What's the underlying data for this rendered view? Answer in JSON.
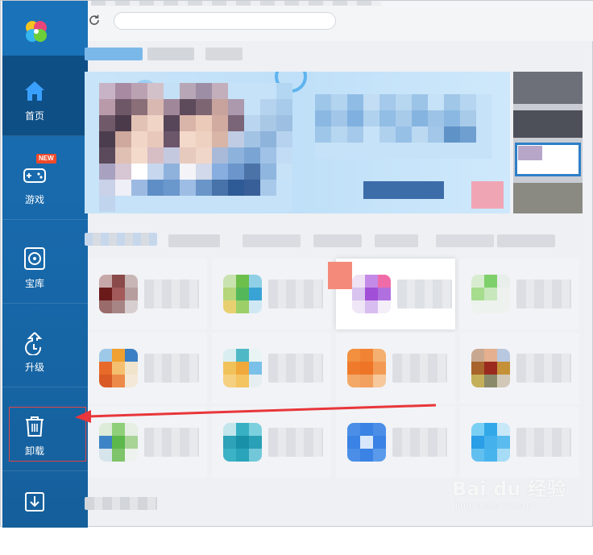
{
  "sidebar": {
    "items": [
      {
        "label": "首页",
        "icon": "home-icon",
        "active": true
      },
      {
        "label": "游戏",
        "icon": "gamepad-icon",
        "badge": "NEW"
      },
      {
        "label": "宝库",
        "icon": "disc-icon"
      },
      {
        "label": "升级",
        "icon": "upgrade-icon"
      },
      {
        "label": "卸载",
        "icon": "trash-icon"
      },
      {
        "label": "",
        "icon": "download-icon"
      }
    ]
  },
  "colors": {
    "sidebar": "#1767a8",
    "sidebar_active": "#0e4f86",
    "badge": "#f04a2a",
    "annotation": "#e04545"
  },
  "watermark": {
    "brand": "Bai du 经验",
    "url": "jingyan.baidu.com"
  }
}
